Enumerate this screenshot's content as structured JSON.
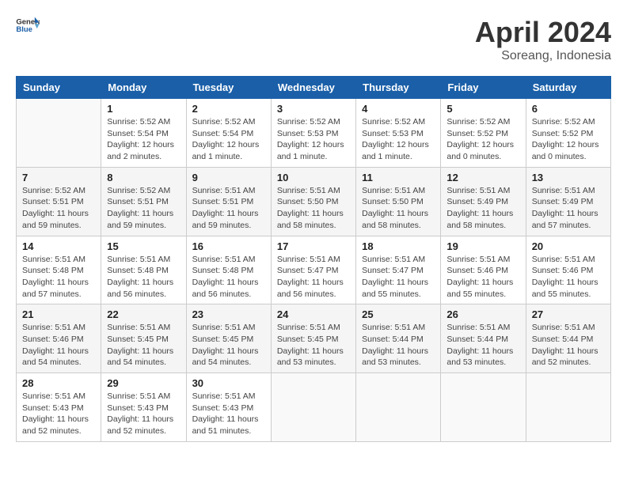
{
  "header": {
    "logo_general": "General",
    "logo_blue": "Blue",
    "month_title": "April 2024",
    "location": "Soreang, Indonesia"
  },
  "weekdays": [
    "Sunday",
    "Monday",
    "Tuesday",
    "Wednesday",
    "Thursday",
    "Friday",
    "Saturday"
  ],
  "weeks": [
    [
      {
        "day": "",
        "detail": ""
      },
      {
        "day": "1",
        "detail": "Sunrise: 5:52 AM\nSunset: 5:54 PM\nDaylight: 12 hours\nand 2 minutes."
      },
      {
        "day": "2",
        "detail": "Sunrise: 5:52 AM\nSunset: 5:54 PM\nDaylight: 12 hours\nand 1 minute."
      },
      {
        "day": "3",
        "detail": "Sunrise: 5:52 AM\nSunset: 5:53 PM\nDaylight: 12 hours\nand 1 minute."
      },
      {
        "day": "4",
        "detail": "Sunrise: 5:52 AM\nSunset: 5:53 PM\nDaylight: 12 hours\nand 1 minute."
      },
      {
        "day": "5",
        "detail": "Sunrise: 5:52 AM\nSunset: 5:52 PM\nDaylight: 12 hours\nand 0 minutes."
      },
      {
        "day": "6",
        "detail": "Sunrise: 5:52 AM\nSunset: 5:52 PM\nDaylight: 12 hours\nand 0 minutes."
      }
    ],
    [
      {
        "day": "7",
        "detail": "Sunrise: 5:52 AM\nSunset: 5:51 PM\nDaylight: 11 hours\nand 59 minutes."
      },
      {
        "day": "8",
        "detail": "Sunrise: 5:52 AM\nSunset: 5:51 PM\nDaylight: 11 hours\nand 59 minutes."
      },
      {
        "day": "9",
        "detail": "Sunrise: 5:51 AM\nSunset: 5:51 PM\nDaylight: 11 hours\nand 59 minutes."
      },
      {
        "day": "10",
        "detail": "Sunrise: 5:51 AM\nSunset: 5:50 PM\nDaylight: 11 hours\nand 58 minutes."
      },
      {
        "day": "11",
        "detail": "Sunrise: 5:51 AM\nSunset: 5:50 PM\nDaylight: 11 hours\nand 58 minutes."
      },
      {
        "day": "12",
        "detail": "Sunrise: 5:51 AM\nSunset: 5:49 PM\nDaylight: 11 hours\nand 58 minutes."
      },
      {
        "day": "13",
        "detail": "Sunrise: 5:51 AM\nSunset: 5:49 PM\nDaylight: 11 hours\nand 57 minutes."
      }
    ],
    [
      {
        "day": "14",
        "detail": "Sunrise: 5:51 AM\nSunset: 5:48 PM\nDaylight: 11 hours\nand 57 minutes."
      },
      {
        "day": "15",
        "detail": "Sunrise: 5:51 AM\nSunset: 5:48 PM\nDaylight: 11 hours\nand 56 minutes."
      },
      {
        "day": "16",
        "detail": "Sunrise: 5:51 AM\nSunset: 5:48 PM\nDaylight: 11 hours\nand 56 minutes."
      },
      {
        "day": "17",
        "detail": "Sunrise: 5:51 AM\nSunset: 5:47 PM\nDaylight: 11 hours\nand 56 minutes."
      },
      {
        "day": "18",
        "detail": "Sunrise: 5:51 AM\nSunset: 5:47 PM\nDaylight: 11 hours\nand 55 minutes."
      },
      {
        "day": "19",
        "detail": "Sunrise: 5:51 AM\nSunset: 5:46 PM\nDaylight: 11 hours\nand 55 minutes."
      },
      {
        "day": "20",
        "detail": "Sunrise: 5:51 AM\nSunset: 5:46 PM\nDaylight: 11 hours\nand 55 minutes."
      }
    ],
    [
      {
        "day": "21",
        "detail": "Sunrise: 5:51 AM\nSunset: 5:46 PM\nDaylight: 11 hours\nand 54 minutes."
      },
      {
        "day": "22",
        "detail": "Sunrise: 5:51 AM\nSunset: 5:45 PM\nDaylight: 11 hours\nand 54 minutes."
      },
      {
        "day": "23",
        "detail": "Sunrise: 5:51 AM\nSunset: 5:45 PM\nDaylight: 11 hours\nand 54 minutes."
      },
      {
        "day": "24",
        "detail": "Sunrise: 5:51 AM\nSunset: 5:45 PM\nDaylight: 11 hours\nand 53 minutes."
      },
      {
        "day": "25",
        "detail": "Sunrise: 5:51 AM\nSunset: 5:44 PM\nDaylight: 11 hours\nand 53 minutes."
      },
      {
        "day": "26",
        "detail": "Sunrise: 5:51 AM\nSunset: 5:44 PM\nDaylight: 11 hours\nand 53 minutes."
      },
      {
        "day": "27",
        "detail": "Sunrise: 5:51 AM\nSunset: 5:44 PM\nDaylight: 11 hours\nand 52 minutes."
      }
    ],
    [
      {
        "day": "28",
        "detail": "Sunrise: 5:51 AM\nSunset: 5:43 PM\nDaylight: 11 hours\nand 52 minutes."
      },
      {
        "day": "29",
        "detail": "Sunrise: 5:51 AM\nSunset: 5:43 PM\nDaylight: 11 hours\nand 52 minutes."
      },
      {
        "day": "30",
        "detail": "Sunrise: 5:51 AM\nSunset: 5:43 PM\nDaylight: 11 hours\nand 51 minutes."
      },
      {
        "day": "",
        "detail": ""
      },
      {
        "day": "",
        "detail": ""
      },
      {
        "day": "",
        "detail": ""
      },
      {
        "day": "",
        "detail": ""
      }
    ]
  ]
}
